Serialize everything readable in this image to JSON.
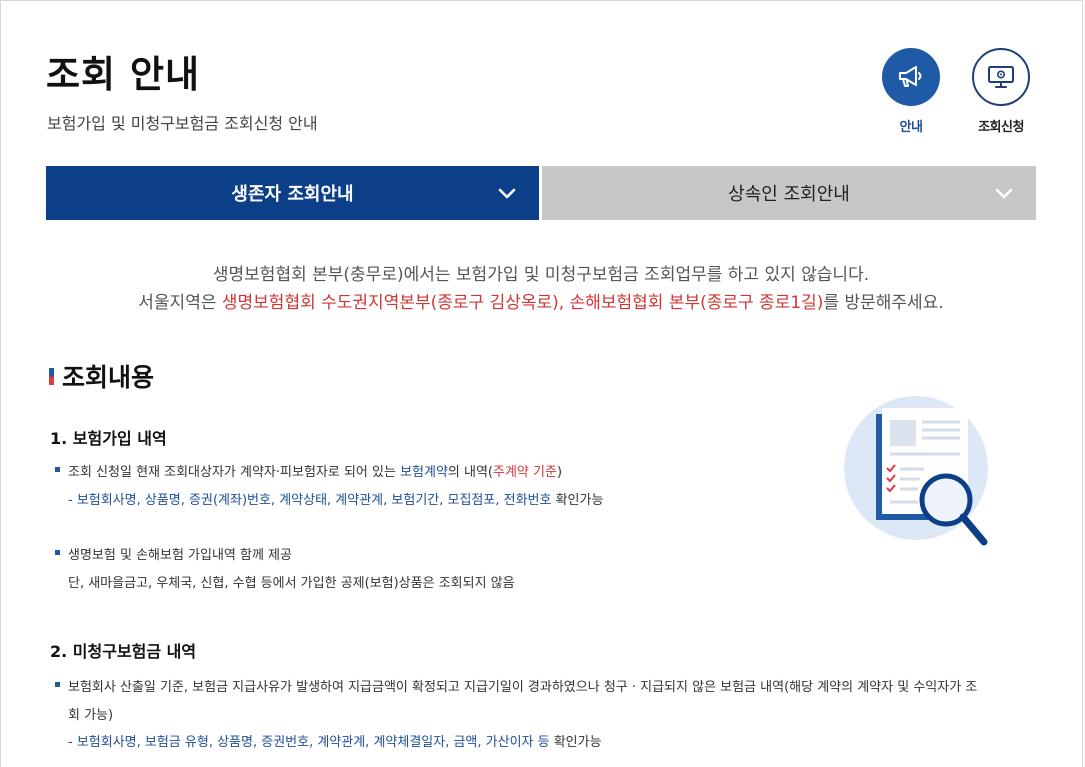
{
  "header": {
    "title": "조회 안내",
    "subtitle": "보험가입 및 미청구보험금 조회신청 안내"
  },
  "quick_menu": [
    {
      "label": "안내",
      "icon": "megaphone-icon"
    },
    {
      "label": "조회신청",
      "icon": "monitor-icon"
    }
  ],
  "tabs": [
    {
      "label": "생존자 조회안내"
    },
    {
      "label": "상속인 조회안내"
    }
  ],
  "notice": {
    "line1": "생명보험협회 본부(충무로)에서는 보험가입 및 미청구보험금 조회업무를 하고 있지 않습니다.",
    "line2_pre": "서울지역은 ",
    "line2_red": "생명보험협회 수도권지역본부(종로구 김상옥로), 손해보험협회 본부(종로구 종로1길)",
    "line2_post": "를 방문해주세요."
  },
  "section": {
    "title": "조회내용",
    "s1": {
      "title": "1. 보험가입 내역",
      "b1_pre": "조회 신청일 현재 조회대상자가 계약자·피보험자로 되어 있는 ",
      "b1_blue": "보험계약",
      "b1_mid": "의 내역(",
      "b1_red": "주계약 기준",
      "b1_post": ")",
      "b1_detail_blue": "- 보험회사명, 상품명, 증권(계좌)번호, 계약상태, 계약관계, 보험기간, 모집점포, 전화번호",
      "b1_detail_post": " 확인가능",
      "b2": "생명보험 및 손해보험 가입내역 함께 제공",
      "b2_detail": "단, 새마을금고, 우체국, 신협, 수협 등에서 가입한 공제(보험)상품은 조회되지 않음"
    },
    "s2": {
      "title": "2. 미청구보험금 내역",
      "b1_line1": "보험회사 산출일 기준, 보험금 지급사유가 발생하여 지급금액이 확정되고 지급기일이 경과하였으나 청구 · 지급되지 않은 보험금 내역(해당 계약의 계약자 및 수익자가 조",
      "b1_line2": "회 가능)",
      "b1_detail_blue": "- 보험회사명, 보험금 유형, 상품명, 증권번호, 계약관계, 계약체결일자, 금액, 가산이자 등",
      "b1_detail_post": " 확인가능"
    }
  },
  "colors": {
    "primary": "#0c3f88",
    "accent_blue": "#1f5aa6",
    "highlight_red": "#d13636",
    "tab_inactive": "#c7c7c7"
  }
}
